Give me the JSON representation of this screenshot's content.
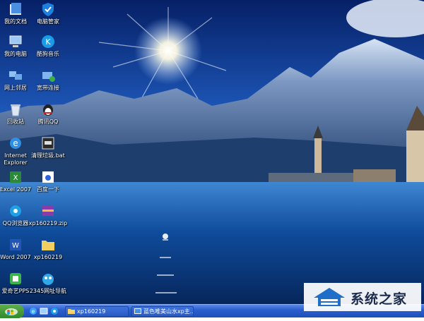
{
  "desktop": {
    "icons": [
      {
        "label": "我的文档",
        "icon": "my-documents-icon"
      },
      {
        "label": "电脑管家",
        "icon": "shield-icon"
      },
      {
        "label": "我的电脑",
        "icon": "my-computer-icon"
      },
      {
        "label": "酷狗音乐",
        "icon": "kugou-icon"
      },
      {
        "label": "网上邻居",
        "icon": "network-icon"
      },
      {
        "label": "宽带连接",
        "icon": "broadband-icon"
      },
      {
        "label": "回收站",
        "icon": "recycle-bin-icon"
      },
      {
        "label": "腾讯QQ",
        "icon": "qq-penguin-icon"
      },
      {
        "label": "Internet Explorer",
        "line1": "Internet",
        "line2": "Explorer",
        "icon": "ie-icon"
      },
      {
        "label": "清理垃圾.bat",
        "icon": "batch-file-icon"
      },
      {
        "label": "Excel 2007",
        "icon": "excel-icon"
      },
      {
        "label": "百度一下",
        "icon": "baidu-icon"
      },
      {
        "label": "QQ浏览器",
        "icon": "qq-browser-icon"
      },
      {
        "label": "xp160219.zip",
        "icon": "zip-archive-icon"
      },
      {
        "label": "Word 2007",
        "icon": "word-icon"
      },
      {
        "label": "xp160219",
        "icon": "folder-icon"
      },
      {
        "label": "爱奇艺PPS",
        "icon": "iqiyi-icon"
      },
      {
        "label": "2345网址导航",
        "icon": "2345-nav-icon"
      }
    ]
  },
  "taskbar": {
    "tasks": [
      {
        "label": "xp160219",
        "icon": "folder-icon"
      },
      {
        "label": "蓝色唯美山水xp主...",
        "icon": "image-icon"
      }
    ]
  },
  "watermark": {
    "text": "系统之家"
  },
  "colors": {
    "taskbar": "#2a5fcf",
    "start": "#3c9a34",
    "sky": "#0c2f7a",
    "lake": "#0d4fa0"
  }
}
